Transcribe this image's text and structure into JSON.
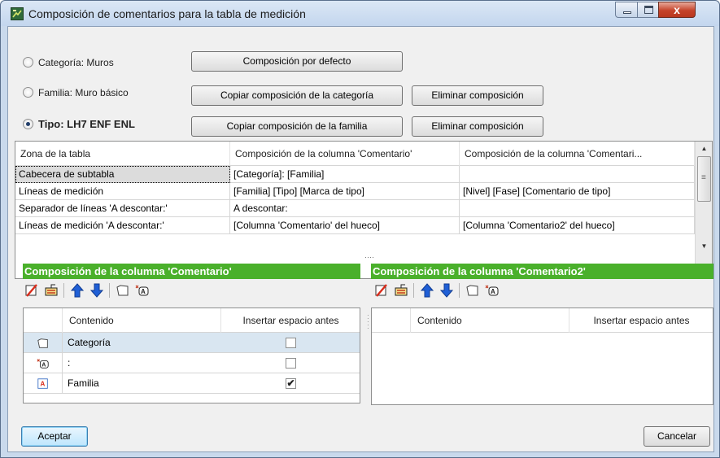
{
  "window": {
    "title": "Composición de comentarios para la tabla de medición",
    "minimize_label": "",
    "close_label": "x"
  },
  "options": {
    "category_label": "Categoría: Muros",
    "family_label": "Familia: Muro básico",
    "type_label": "Tipo: LH7 ENF ENL",
    "selected": "type"
  },
  "buttons": {
    "default_composition": "Composición por defecto",
    "copy_from_category": "Copiar composición de la categoría",
    "delete_family_composition": "Eliminar composición",
    "copy_from_family": "Copiar composición de la familia",
    "delete_type_composition": "Eliminar composición",
    "accept": "Aceptar",
    "cancel": "Cancelar"
  },
  "main_table": {
    "headers": [
      "Zona de la tabla",
      "Composición de la columna 'Comentario'",
      "Composición de la columna 'Comentari..."
    ],
    "rows": [
      [
        "Cabecera de subtabla",
        "[Categoría]: [Familia]",
        ""
      ],
      [
        "Líneas de medición",
        "[Familia] [Tipo] [Marca de tipo]",
        "[Nivel] [Fase] [Comentario de tipo]"
      ],
      [
        "Separador de líneas 'A descontar:'",
        "A descontar:",
        ""
      ],
      [
        "Líneas de medición 'A descontar:'",
        "[Columna 'Comentario' del hueco]",
        "[Columna 'Comentario2' del hueco]"
      ]
    ]
  },
  "left_panel": {
    "title": "Composición de la columna 'Comentario'",
    "headers": [
      "",
      "Contenido",
      "Insertar espacio antes"
    ],
    "rows": [
      {
        "icon": "folder-icon",
        "content": "Categoría",
        "insert_space": false
      },
      {
        "icon": "text-tag-icon",
        "content": ":",
        "insert_space": false
      },
      {
        "icon": "parameter-icon",
        "content": "Familia",
        "insert_space": true
      }
    ]
  },
  "right_panel": {
    "title": "Composición de la columna 'Comentario2'",
    "headers": [
      "",
      "Contenido",
      "Insertar espacio antes"
    ],
    "rows": []
  },
  "colors": {
    "green_header": "#4ab02b",
    "selected_row": "#d9e6f1",
    "arrow_blue": "#1f5fd6",
    "delete_red": "#d92b1a"
  }
}
